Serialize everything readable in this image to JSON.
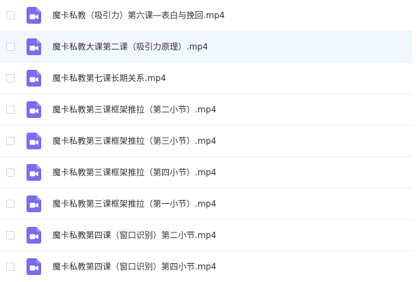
{
  "colors": {
    "icon_purple": "#7b6ce9",
    "row_selected": "#f2f8ff",
    "divider": "#eef0f3",
    "text": "#333333"
  },
  "files": [
    {
      "name": "魔卡私教（吸引力）第六课—表白与挽回.mp4",
      "icon": "video-file-icon",
      "selected": false
    },
    {
      "name": "魔卡私教大课第二课（吸引力原理）.mp4",
      "icon": "video-file-icon",
      "selected": true
    },
    {
      "name": "魔卡私教第七课长期关系.mp4",
      "icon": "video-file-icon",
      "selected": false
    },
    {
      "name": "魔卡私教第三课框架推拉（第二小节）.mp4",
      "icon": "video-file-icon",
      "selected": false
    },
    {
      "name": "魔卡私教第三课框架推拉（第三小节）.mp4",
      "icon": "video-file-icon",
      "selected": false
    },
    {
      "name": "魔卡私教第三课框架推拉（第四小节）.mp4",
      "icon": "video-file-icon",
      "selected": false
    },
    {
      "name": "魔卡私教第三课框架推拉（第一小节）.mp4",
      "icon": "video-file-icon",
      "selected": false
    },
    {
      "name": "魔卡私教第四课（窗口识别）第二小节.mp4",
      "icon": "video-file-icon",
      "selected": false
    },
    {
      "name": "魔卡私教第四课（窗口识别）第四小节.mp4",
      "icon": "video-file-icon",
      "selected": false
    }
  ]
}
